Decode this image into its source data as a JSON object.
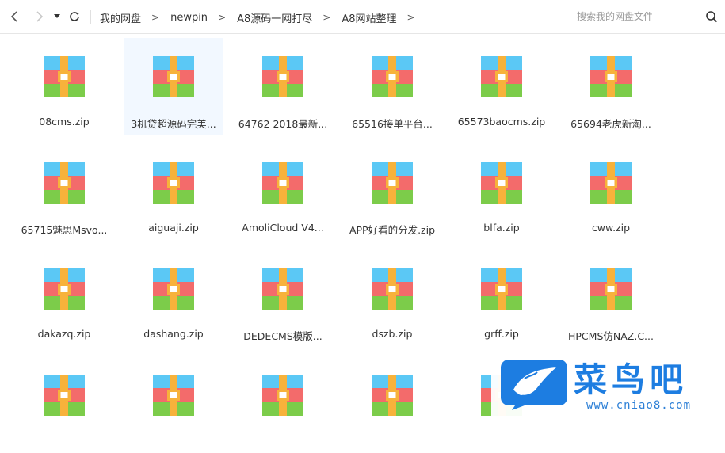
{
  "toolbar": {
    "back_icon": "chevron-left-icon",
    "forward_icon": "chevron-right-icon",
    "dropdown_icon": "caret-down-icon",
    "refresh_icon": "refresh-icon",
    "breadcrumbs": [
      "我的网盘",
      "newpin",
      "A8源码一网打尽",
      "A8网站整理"
    ],
    "breadcrumb_separator": ">",
    "search_placeholder": "搜索我的网盘文件"
  },
  "files": [
    {
      "name": "08cms.zip"
    },
    {
      "name": "3机贷超源码完美...",
      "selected": true
    },
    {
      "name": "64762 2018最新..."
    },
    {
      "name": "65516接单平台..."
    },
    {
      "name": "65573baocms.zip"
    },
    {
      "name": "65694老虎新淘..."
    },
    {
      "name": "65715魅思Msvo..."
    },
    {
      "name": "aiguaji.zip"
    },
    {
      "name": "AmoliCloud V4..."
    },
    {
      "name": "APP好看的分发.zip"
    },
    {
      "name": "blfa.zip"
    },
    {
      "name": "cww.zip"
    },
    {
      "name": "dakazq.zip"
    },
    {
      "name": "dashang.zip"
    },
    {
      "name": "DEDECMS模版..."
    },
    {
      "name": "dszb.zip"
    },
    {
      "name": "grff.zip"
    },
    {
      "name": "HPCMS仿NAZ.C..."
    },
    {
      "name": ""
    },
    {
      "name": ""
    },
    {
      "name": ""
    },
    {
      "name": ""
    },
    {
      "name": ""
    }
  ],
  "file_icon": "zip-archive-icon",
  "colors": {
    "zip_top": "#5bc8f5",
    "zip_middle": "#f36b6b",
    "zip_bottom": "#7ccc4a",
    "zip_strap": "#f7b23b",
    "selected_bg": "#f2f8ff"
  },
  "watermark": {
    "title": "菜鸟吧",
    "url": "www.cniao8.com",
    "logo_icon": "bird-logo-icon"
  }
}
